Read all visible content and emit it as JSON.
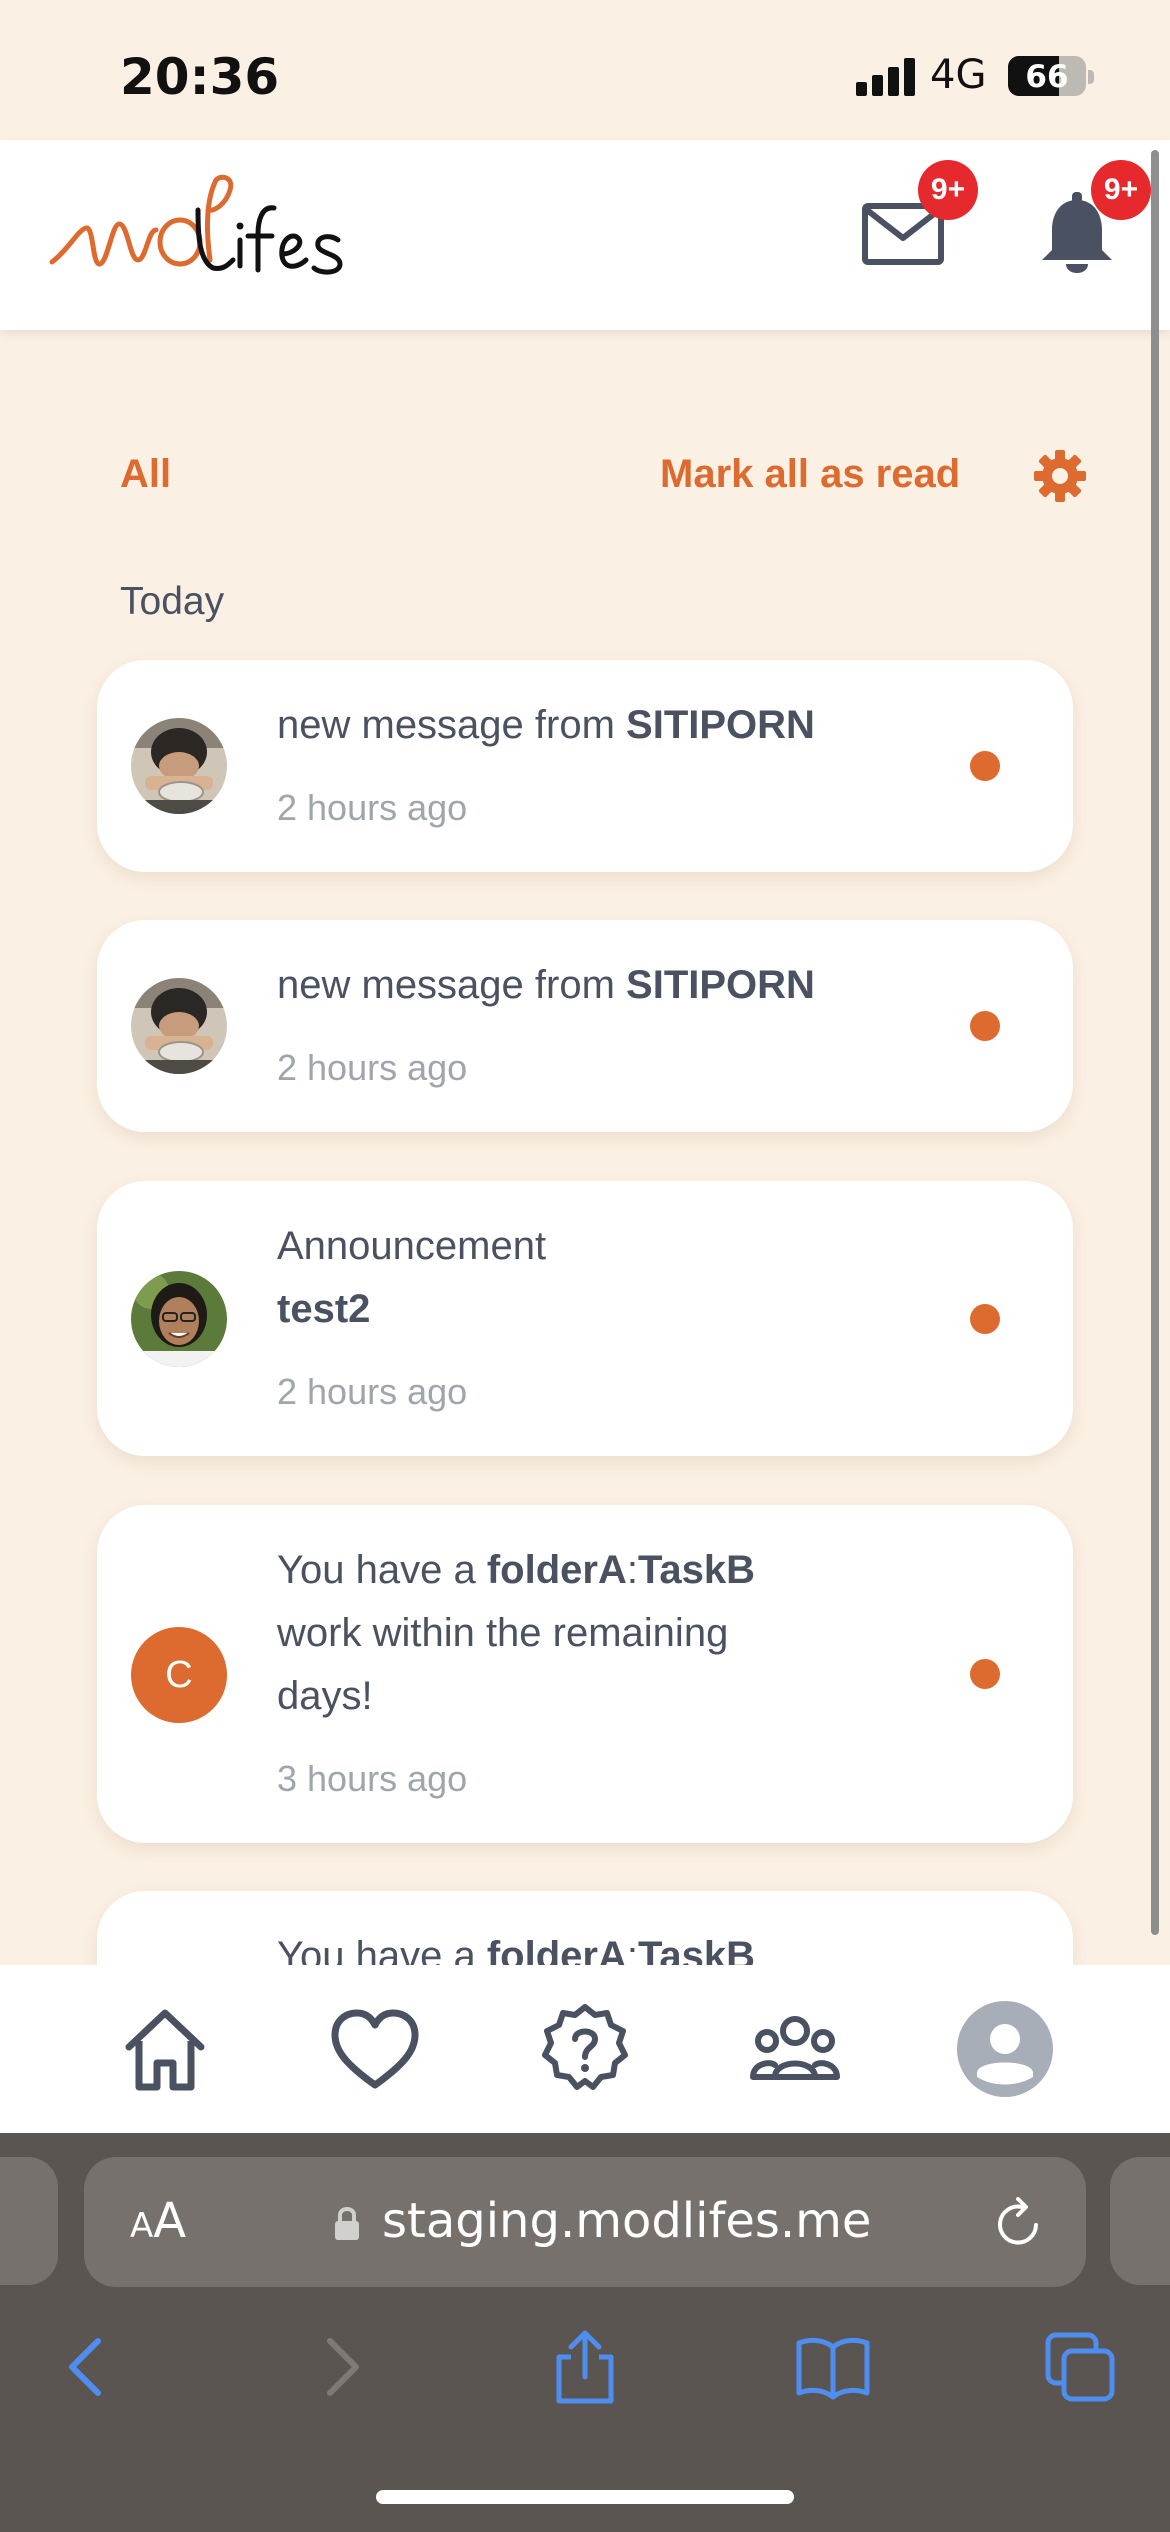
{
  "status_bar": {
    "time": "20:36",
    "network": "4G",
    "battery": "66",
    "battery_level": 0.66
  },
  "header": {
    "logo_text": "ModLifes",
    "mail_badge": "9+",
    "bell_badge": "9+"
  },
  "filters": {
    "all_label": "All",
    "mark_all_label": "Mark all as read"
  },
  "section_today": "Today",
  "notifications": [
    {
      "prefix": "new message from ",
      "bold": "SITIPORN",
      "time": "2 hours ago",
      "avatar": "photo-boy"
    },
    {
      "prefix": "new message from ",
      "bold": "SITIPORN",
      "time": "2 hours ago",
      "avatar": "photo-boy"
    },
    {
      "line1": "Announcement",
      "bold": "test2",
      "time": "2 hours ago",
      "avatar": "photo-girl"
    },
    {
      "prefix": "You have a ",
      "bold": "folderA",
      "sep": ":",
      "bold2": "TaskB",
      "rest_line2": "work within the remaining",
      "rest_line3": "days!",
      "time": "3 hours ago",
      "avatar_letter": "C"
    },
    {
      "prefix": "You have a ",
      "bold": "folderA",
      "sep": ":",
      "bold2": "TaskB"
    }
  ],
  "browser": {
    "text_size_label": "A",
    "text_size_label_large": "A",
    "url": "staging.modlifes.me"
  },
  "colors": {
    "accent": "#DD6A2E",
    "badge": "#E5292D",
    "background": "#FBF0E4",
    "text": "#4A5160"
  },
  "icons": {
    "nav": [
      "home-icon",
      "heart-icon",
      "help-icon",
      "community-icon",
      "profile-icon"
    ],
    "toolbar": [
      "back-icon",
      "forward-icon",
      "share-icon",
      "bookmarks-icon",
      "tabs-icon"
    ]
  }
}
